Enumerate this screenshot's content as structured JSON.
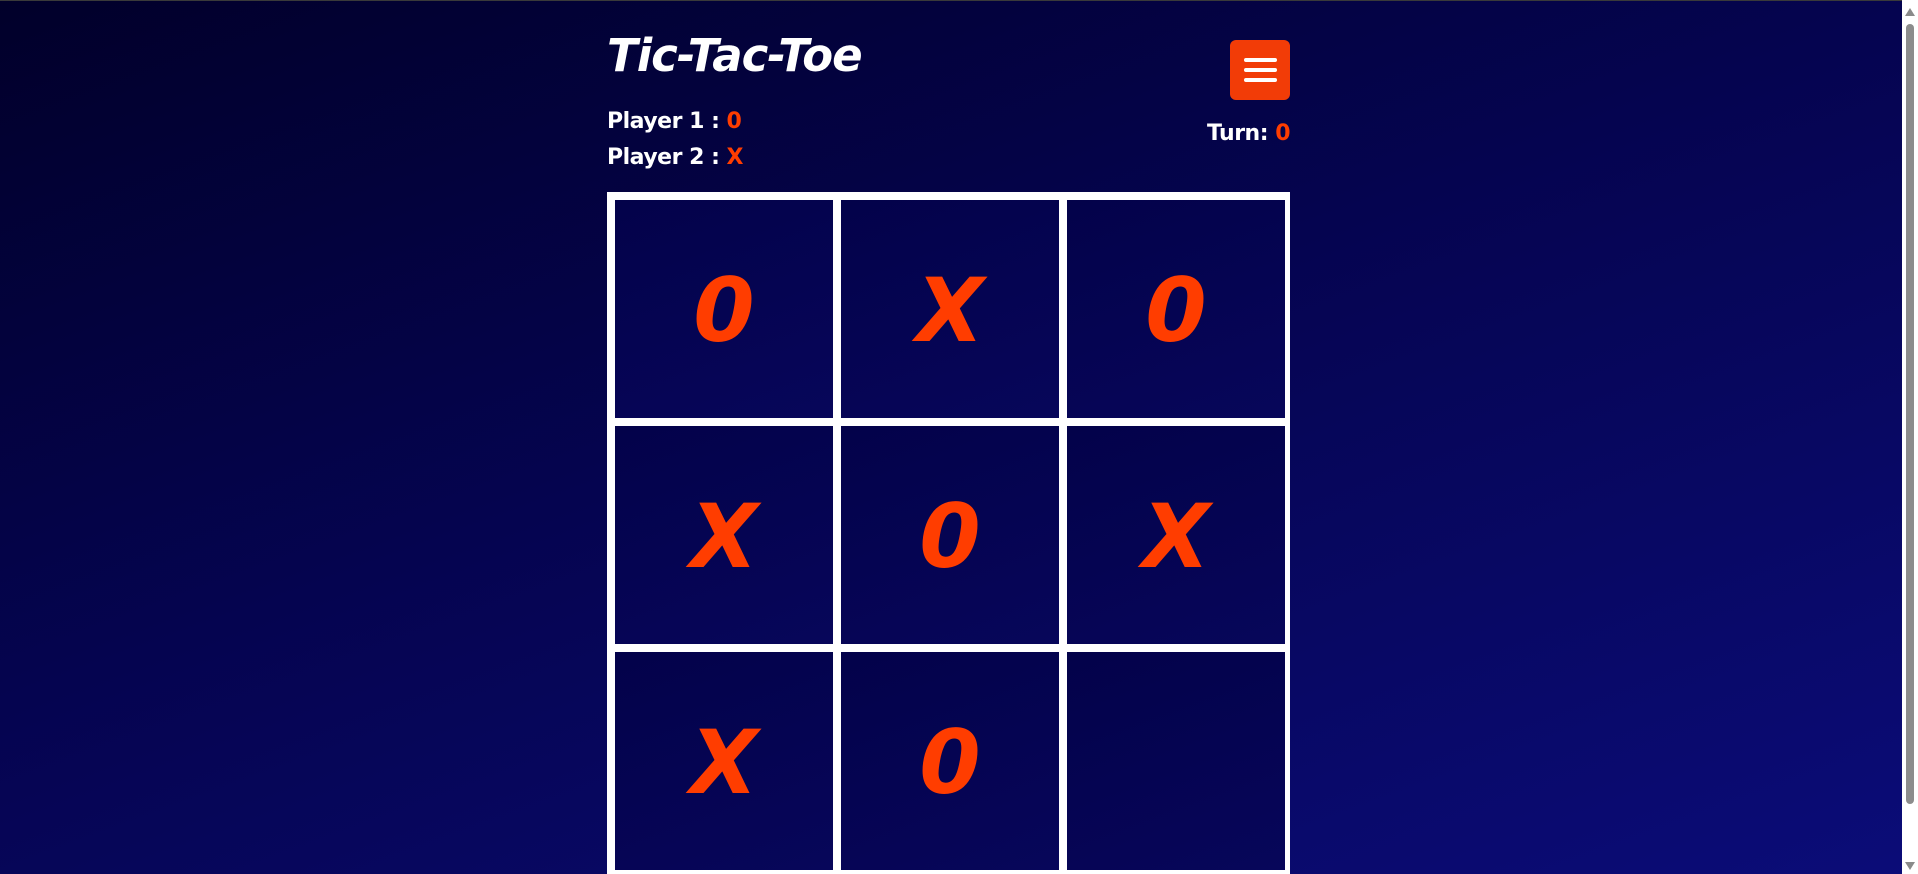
{
  "header": {
    "title": "Tic-Tac-Toe",
    "menu_icon": "hamburger-menu-icon"
  },
  "players": {
    "player1_label": "Player 1 : ",
    "player1_symbol": "0",
    "player2_label": "Player 2 : ",
    "player2_symbol": "X"
  },
  "turn": {
    "label": "Turn: ",
    "symbol": "0"
  },
  "board": {
    "cells": [
      "0",
      "X",
      "0",
      "X",
      "0",
      "X",
      "X",
      "0",
      ""
    ]
  },
  "colors": {
    "accent": "#ff3d00",
    "menu_button": "#f23c07",
    "board_lines": "#ffffff",
    "background_start": "#01002a",
    "background_end": "#0b0c78"
  }
}
